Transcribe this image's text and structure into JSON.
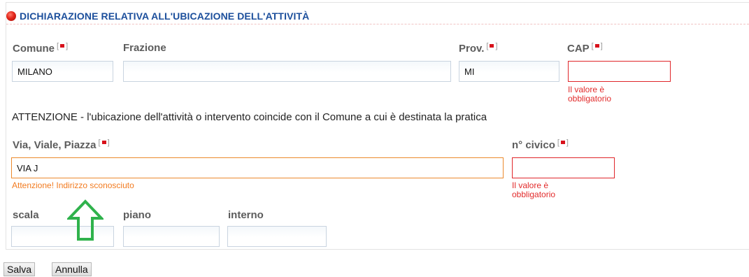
{
  "section": {
    "title": "DICHIARAZIONE RELATIVA ALL'UBICAZIONE DELL'ATTIVITÀ"
  },
  "fields": {
    "comune": {
      "label": "Comune",
      "value": "MILANO"
    },
    "frazione": {
      "label": "Frazione",
      "value": ""
    },
    "prov": {
      "label": "Prov.",
      "value": "MI"
    },
    "cap": {
      "label": "CAP",
      "value": "",
      "error": "Il valore è obbligatorio"
    },
    "via": {
      "label": "Via, Viale, Piazza",
      "value": "VIA J",
      "warning": "Attenzione! Indirizzo sconosciuto"
    },
    "civico": {
      "label": "n° civico",
      "value": "",
      "error": "Il valore è obbligatorio"
    },
    "scala": {
      "label": "scala",
      "value": ""
    },
    "piano": {
      "label": "piano",
      "value": ""
    },
    "interno": {
      "label": "interno",
      "value": ""
    }
  },
  "notice": "ATTENZIONE - l'ubicazione dell'attività o intervento coincide con il Comune a cui è destinata la pratica",
  "buttons": {
    "save": "Salva",
    "cancel": "Annulla"
  },
  "colors": {
    "title": "#1c4f9c",
    "error": "#e22b2b",
    "warning": "#f27b20",
    "arrow": "#2fb24c"
  }
}
